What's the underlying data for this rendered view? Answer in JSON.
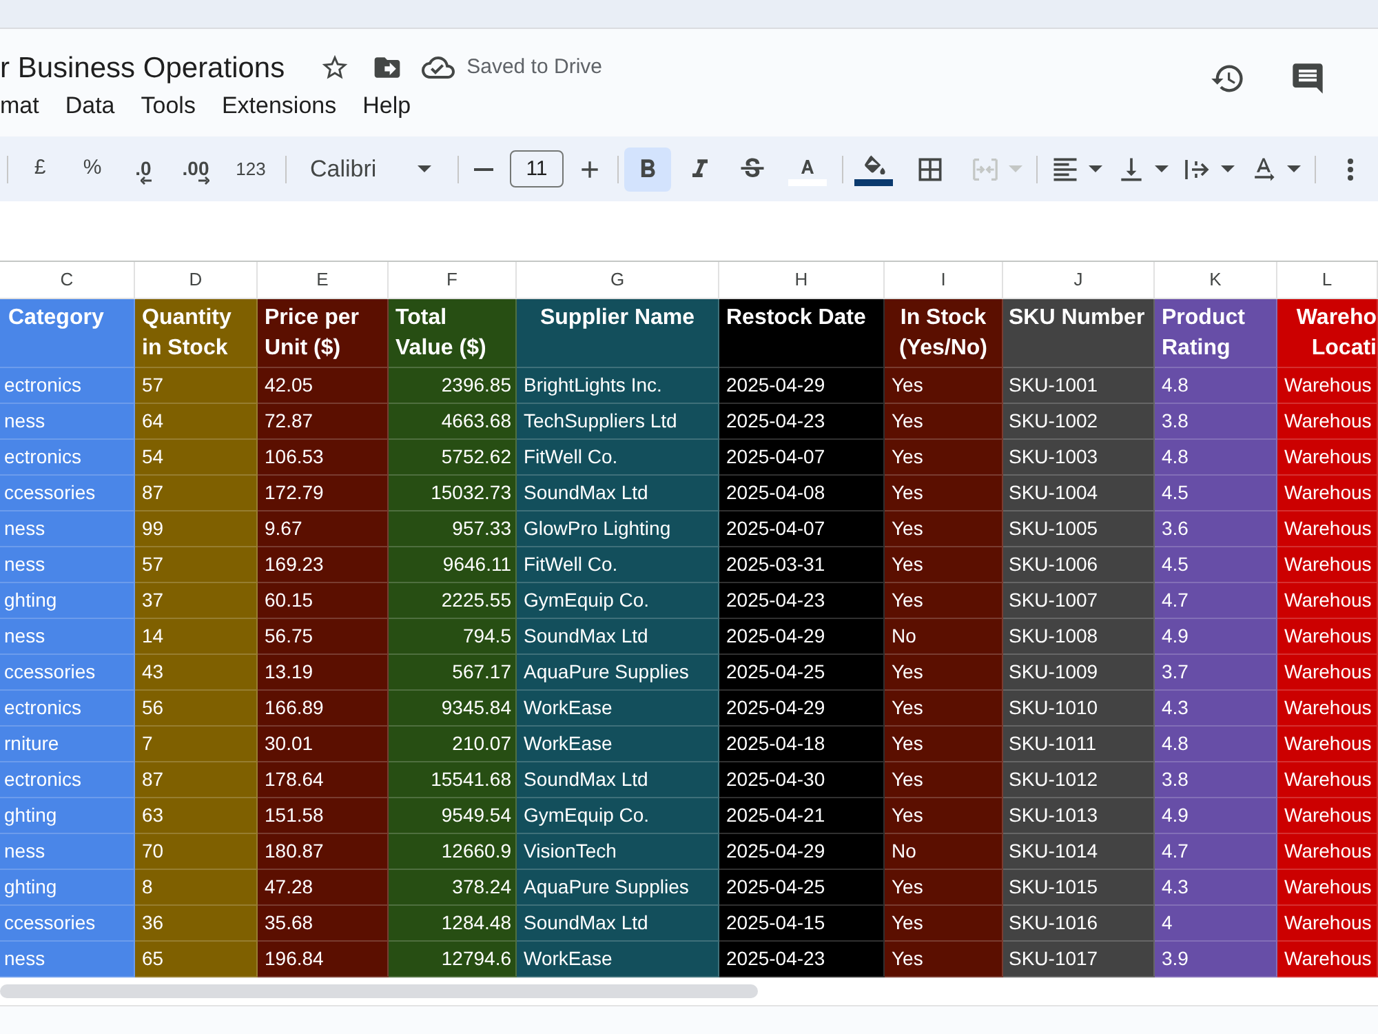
{
  "document": {
    "title": "r Business Operations",
    "save_status": "Saved to Drive"
  },
  "menu": [
    "mat",
    "Data",
    "Tools",
    "Extensions",
    "Help"
  ],
  "toolbar": {
    "currency": "£",
    "percent": "%",
    "decrease_decimals": ".0",
    "increase_decimals": ".00",
    "number_format": "123",
    "font": "Calibri",
    "font_size": "11",
    "bold": true,
    "italic": false,
    "strikethrough": false,
    "merge_disabled": true
  },
  "sheet": {
    "columns": [
      {
        "letter": "C",
        "header": "Category",
        "color": "#4a86e8"
      },
      {
        "letter": "D",
        "header": "Quantity in Stock",
        "color": "#7f6000"
      },
      {
        "letter": "E",
        "header": "Price per Unit ($)",
        "color": "#5b0f00"
      },
      {
        "letter": "F",
        "header": "Total Value ($)",
        "color": "#274e13"
      },
      {
        "letter": "G",
        "header": "Supplier Name",
        "color": "#134f5c"
      },
      {
        "letter": "H",
        "header": "Restock Date",
        "color": "#000000"
      },
      {
        "letter": "I",
        "header": "In Stock (Yes/No)",
        "color": "#5b0f00"
      },
      {
        "letter": "J",
        "header": "SKU Number",
        "color": "#434343"
      },
      {
        "letter": "K",
        "header": "Product Rating",
        "color": "#674ea7"
      },
      {
        "letter": "L",
        "header": "Wareho Locati",
        "color": "#cc0000"
      }
    ],
    "rows": [
      [
        "ectronics",
        "57",
        "42.05",
        "2396.85",
        "BrightLights Inc.",
        "2025-04-29",
        "Yes",
        "SKU-1001",
        "4.8",
        "Warehous"
      ],
      [
        "ness",
        "64",
        "72.87",
        "4663.68",
        "TechSuppliers Ltd",
        "2025-04-23",
        "Yes",
        "SKU-1002",
        "3.8",
        "Warehous"
      ],
      [
        "ectronics",
        "54",
        "106.53",
        "5752.62",
        "FitWell Co.",
        "2025-04-07",
        "Yes",
        "SKU-1003",
        "4.8",
        "Warehous"
      ],
      [
        "ccessories",
        "87",
        "172.79",
        "15032.73",
        "SoundMax Ltd",
        "2025-04-08",
        "Yes",
        "SKU-1004",
        "4.5",
        "Warehous"
      ],
      [
        "ness",
        "99",
        "9.67",
        "957.33",
        "GlowPro Lighting",
        "2025-04-07",
        "Yes",
        "SKU-1005",
        "3.6",
        "Warehous"
      ],
      [
        "ness",
        "57",
        "169.23",
        "9646.11",
        "FitWell Co.",
        "2025-03-31",
        "Yes",
        "SKU-1006",
        "4.5",
        "Warehous"
      ],
      [
        "ghting",
        "37",
        "60.15",
        "2225.55",
        "GymEquip Co.",
        "2025-04-23",
        "Yes",
        "SKU-1007",
        "4.7",
        "Warehous"
      ],
      [
        "ness",
        "14",
        "56.75",
        "794.5",
        "SoundMax Ltd",
        "2025-04-29",
        "No",
        "SKU-1008",
        "4.9",
        "Warehous"
      ],
      [
        "ccessories",
        "43",
        "13.19",
        "567.17",
        "AquaPure Supplies",
        "2025-04-25",
        "Yes",
        "SKU-1009",
        "3.7",
        "Warehous"
      ],
      [
        "ectronics",
        "56",
        "166.89",
        "9345.84",
        "WorkEase",
        "2025-04-29",
        "Yes",
        "SKU-1010",
        "4.3",
        "Warehous"
      ],
      [
        "rniture",
        "7",
        "30.01",
        "210.07",
        "WorkEase",
        "2025-04-18",
        "Yes",
        "SKU-1011",
        "4.8",
        "Warehous"
      ],
      [
        "ectronics",
        "87",
        "178.64",
        "15541.68",
        "SoundMax Ltd",
        "2025-04-30",
        "Yes",
        "SKU-1012",
        "3.8",
        "Warehous"
      ],
      [
        "ghting",
        "63",
        "151.58",
        "9549.54",
        "GymEquip Co.",
        "2025-04-21",
        "Yes",
        "SKU-1013",
        "4.9",
        "Warehous"
      ],
      [
        "ness",
        "70",
        "180.87",
        "12660.9",
        "VisionTech",
        "2025-04-29",
        "No",
        "SKU-1014",
        "4.7",
        "Warehous"
      ],
      [
        "ghting",
        "8",
        "47.28",
        "378.24",
        "AquaPure Supplies",
        "2025-04-25",
        "Yes",
        "SKU-1015",
        "4.3",
        "Warehous"
      ],
      [
        "ccessories",
        "36",
        "35.68",
        "1284.48",
        "SoundMax Ltd",
        "2025-04-15",
        "Yes",
        "SKU-1016",
        "4",
        "Warehous"
      ],
      [
        "ness",
        "65",
        "196.84",
        "12794.6",
        "WorkEase",
        "2025-04-23",
        "Yes",
        "SKU-1017",
        "3.9",
        "Warehous"
      ]
    ]
  }
}
